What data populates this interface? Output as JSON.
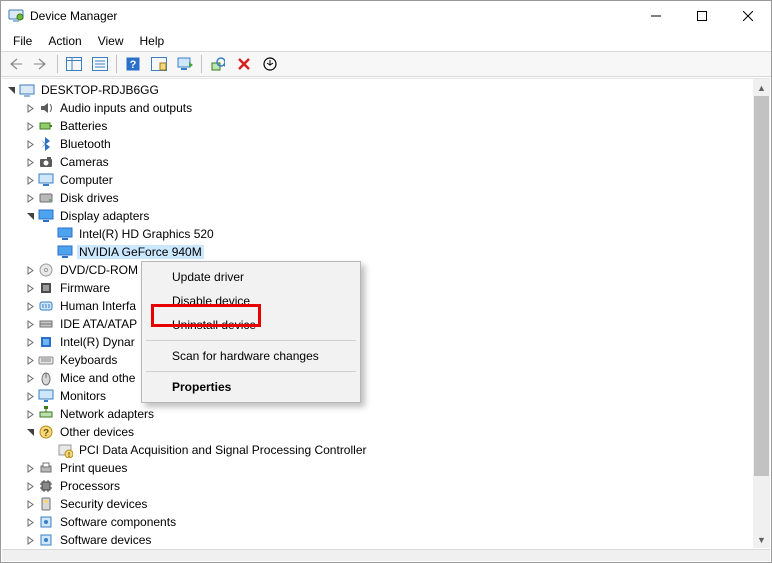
{
  "window": {
    "title": "Device Manager"
  },
  "menu": {
    "file": "File",
    "action": "Action",
    "view": "View",
    "help": "Help"
  },
  "tree": {
    "root": "DESKTOP-RDJB6GG",
    "items": [
      {
        "label": "Audio inputs and outputs",
        "icon": "audio"
      },
      {
        "label": "Batteries",
        "icon": "battery"
      },
      {
        "label": "Bluetooth",
        "icon": "bluetooth"
      },
      {
        "label": "Cameras",
        "icon": "camera"
      },
      {
        "label": "Computer",
        "icon": "computer"
      },
      {
        "label": "Disk drives",
        "icon": "disk"
      },
      {
        "label": "Display adapters",
        "icon": "display",
        "expanded": true,
        "children": [
          {
            "label": "Intel(R) HD Graphics 520",
            "icon": "display"
          },
          {
            "label": "NVIDIA GeForce 940M",
            "icon": "display",
            "selected": true
          }
        ]
      },
      {
        "label": "DVD/CD-ROM",
        "icon": "dvd",
        "truncated": true
      },
      {
        "label": "Firmware",
        "icon": "firmware"
      },
      {
        "label": "Human Interfa",
        "icon": "hid",
        "truncated": true
      },
      {
        "label": "IDE ATA/ATAP",
        "icon": "ide",
        "truncated": true
      },
      {
        "label": "Intel(R) Dynar",
        "icon": "intel",
        "truncated": true
      },
      {
        "label": "Keyboards",
        "icon": "keyboard"
      },
      {
        "label": "Mice and othe",
        "icon": "mouse",
        "truncated": true
      },
      {
        "label": "Monitors",
        "icon": "monitor"
      },
      {
        "label": "Network adapters",
        "icon": "network"
      },
      {
        "label": "Other devices",
        "icon": "other",
        "expanded": true,
        "children": [
          {
            "label": "PCI Data Acquisition and Signal Processing Controller",
            "icon": "unknown"
          }
        ]
      },
      {
        "label": "Print queues",
        "icon": "printer"
      },
      {
        "label": "Processors",
        "icon": "cpu"
      },
      {
        "label": "Security devices",
        "icon": "security"
      },
      {
        "label": "Software components",
        "icon": "soft"
      },
      {
        "label": "Software devices",
        "icon": "soft"
      }
    ]
  },
  "context_menu": {
    "update": "Update driver",
    "disable": "Disable device",
    "uninstall": "Uninstall device",
    "scan": "Scan for hardware changes",
    "properties": "Properties"
  },
  "scroll": {
    "thumb_top": 0,
    "thumb_height": 380
  }
}
